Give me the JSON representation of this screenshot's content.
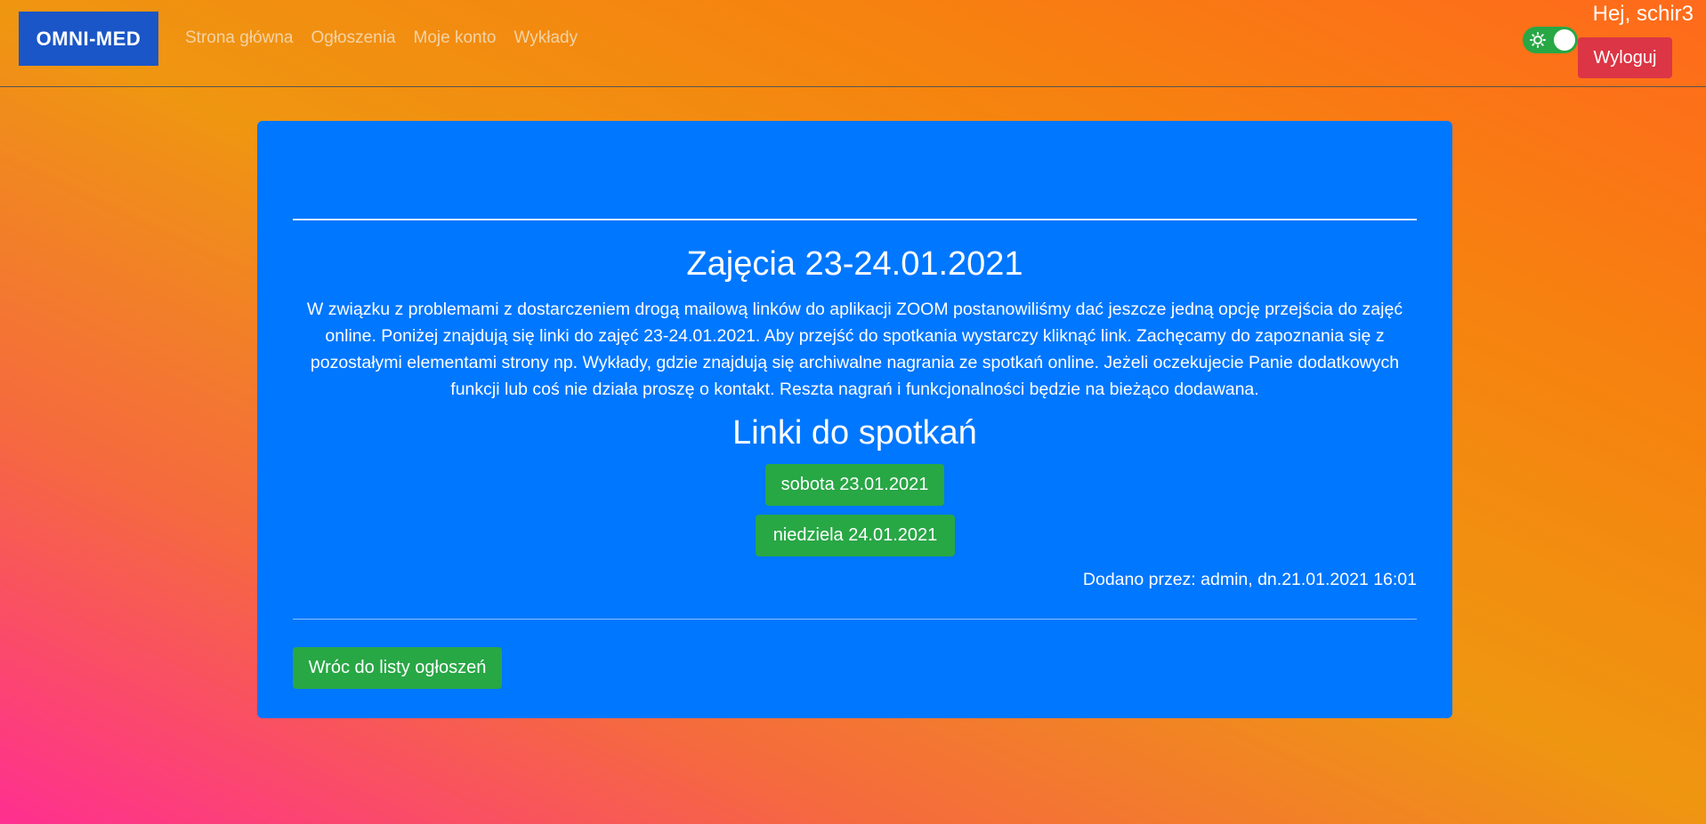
{
  "navbar": {
    "brand": "OMNI-MED",
    "links": [
      "Strona główna",
      "Ogłoszenia",
      "Moje konto",
      "Wykłady"
    ],
    "greeting": "Hej, schir3",
    "logout_label": "Wyloguj",
    "theme_toggle_icon": "sun-icon",
    "theme_toggle_state": "on"
  },
  "post": {
    "title": "Zajęcia 23-24.01.2021",
    "body": "W związku z problemami z dostarczeniem drogą mailową linków do aplikacji ZOOM postanowiliśmy dać jeszcze jedną opcję przejścia do zajęć online. Poniżej znajdują się linki do zajęć 23-24.01.2021. Aby przejść do spotkania wystarczy kliknąć link. Zachęcamy do zapoznania się z pozostałymi elementami strony np. Wykłady, gdzie znajdują się archiwalne nagrania ze spotkań online. Jeżeli oczekujecie Panie dodatkowych funkcji lub coś nie działa proszę o kontakt. Reszta nagrań i funkcjonalności będzie na bieżąco dodawana.",
    "links_heading": "Linki do spotkań",
    "meeting_links": [
      "sobota 23.01.2021",
      "niedziela 24.01.2021"
    ],
    "added_by": "Dodano przez: admin, dn.21.01.2021 16:01",
    "back_label": "Wróc do listy ogłoszeń"
  },
  "colors": {
    "card": "#0077ff",
    "brand": "#1a56c7",
    "success": "#28a745",
    "danger": "#dc3545"
  }
}
